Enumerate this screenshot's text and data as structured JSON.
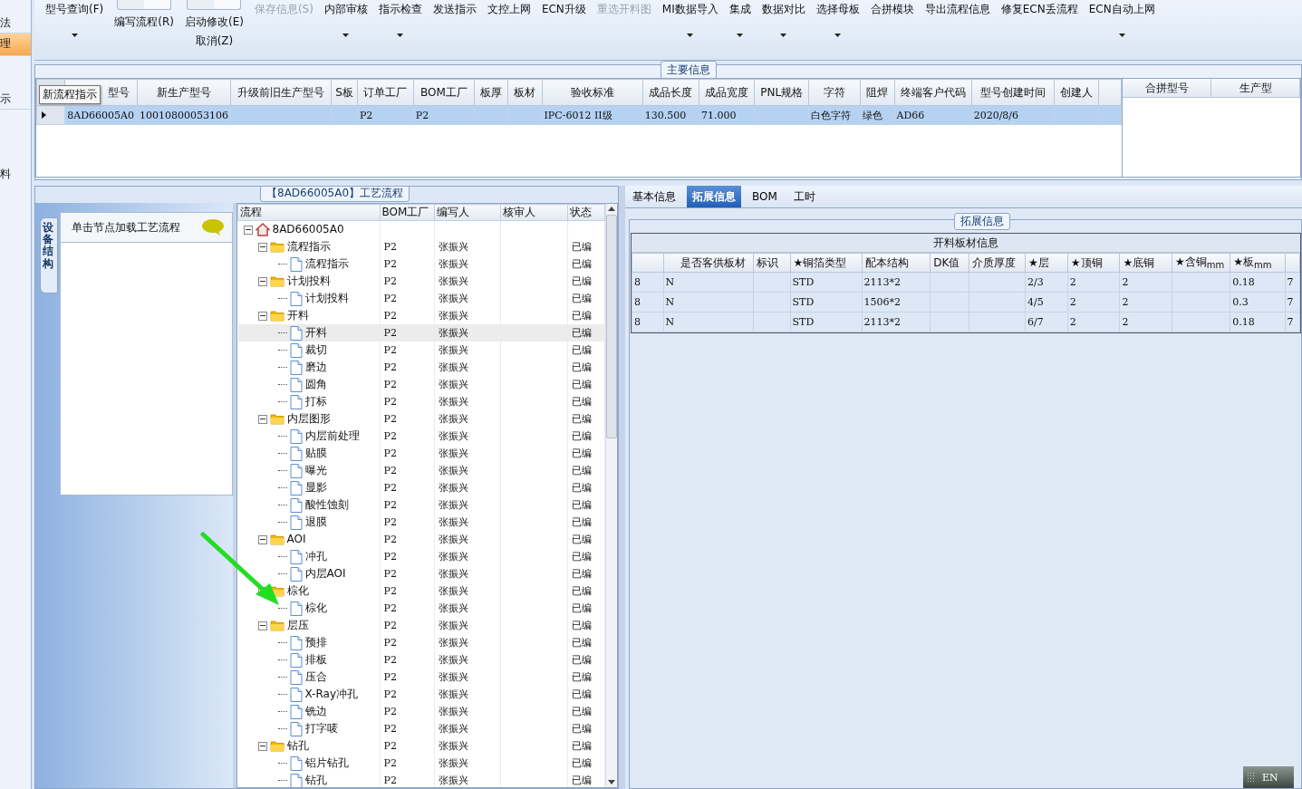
{
  "side_nav": [
    {
      "label": "法",
      "selected": false
    },
    {
      "label": "理",
      "selected": true
    },
    {
      "label": "示",
      "selected": false
    },
    {
      "label": "料",
      "selected": false
    }
  ],
  "toolbar": [
    {
      "kind": "menu",
      "label": "型号查询(F)",
      "dropdown": true,
      "disabled": false
    },
    {
      "kind": "toggle",
      "label": "编写流程(R)",
      "on": false
    },
    {
      "kind": "toggle",
      "label": "启动修改(E)",
      "sublabel": "取消(Z)",
      "on": false
    },
    {
      "kind": "menu",
      "label": "保存信息(S)",
      "dropdown": false,
      "disabled": true
    },
    {
      "kind": "menu",
      "label": "内部审核",
      "dropdown": true,
      "disabled": false
    },
    {
      "kind": "menu",
      "label": "指示检查",
      "dropdown": true,
      "disabled": false
    },
    {
      "kind": "menu",
      "label": "发送指示",
      "dropdown": false,
      "disabled": false
    },
    {
      "kind": "menu",
      "label": "文控上网",
      "dropdown": false,
      "disabled": false
    },
    {
      "kind": "menu",
      "label": "ECN升级",
      "dropdown": false,
      "disabled": false
    },
    {
      "kind": "menu",
      "label": "重选开料图",
      "dropdown": false,
      "disabled": true
    },
    {
      "kind": "menu",
      "label": "MI数据导入",
      "dropdown": true,
      "disabled": false
    },
    {
      "kind": "menu",
      "label": "集成",
      "dropdown": true,
      "disabled": false
    },
    {
      "kind": "menu",
      "label": "数据对比",
      "dropdown": true,
      "disabled": false
    },
    {
      "kind": "menu",
      "label": "选择母板",
      "dropdown": true,
      "disabled": false
    },
    {
      "kind": "menu",
      "label": "合拼模块",
      "dropdown": false,
      "disabled": false
    },
    {
      "kind": "menu",
      "label": "导出流程信息",
      "dropdown": false,
      "disabled": false
    },
    {
      "kind": "menu",
      "label": "修复ECN丢流程",
      "dropdown": false,
      "disabled": false
    },
    {
      "kind": "menu",
      "label": "ECN自动上网",
      "dropdown": true,
      "disabled": false
    }
  ],
  "main_info": {
    "title": "主要信息",
    "tooltip": "新流程指示",
    "columns": [
      "型号",
      "新生产型号",
      "升级前旧生产型号",
      "S板",
      "订单工厂",
      "BOM工厂",
      "板厚",
      "板材",
      "验收标准",
      "成品长度",
      "成品宽度",
      "PNL规格",
      "字符",
      "阻焊",
      "终端客户代码",
      "型号创建时间",
      "创建人"
    ],
    "rows": [
      {
        "selected": true,
        "cells": [
          "8AD66005A0",
          "10010800053106",
          "",
          "",
          "P2",
          "P2",
          "",
          "",
          "IPC-6012 II级",
          "130.500",
          "71.000",
          "",
          "白色字符",
          "绿色",
          "AD66",
          "2020/8/6",
          ""
        ]
      }
    ],
    "merge_columns": [
      "合拼型号",
      "生产型"
    ]
  },
  "process": {
    "title": "【8AD66005A0】工艺流程",
    "side_tab": "设备结构",
    "hint": "单击节点加载工艺流程",
    "columns": [
      "流程",
      "BOM工厂",
      "编写人",
      "核审人",
      "状态"
    ],
    "tree": [
      {
        "kind": "root",
        "label": "8AD66005A0",
        "selected": false,
        "expanded": true,
        "children": [
          {
            "kind": "folder",
            "label": "流程指示",
            "bom": "P2",
            "writer": "张振兴",
            "status": "已编",
            "selected": false,
            "expanded": true,
            "children": [
              {
                "kind": "file",
                "label": "流程指示",
                "bom": "P2",
                "writer": "张振兴",
                "status": "已编",
                "selected": false
              }
            ]
          },
          {
            "kind": "folder",
            "label": "计划投料",
            "bom": "P2",
            "writer": "张振兴",
            "status": "已编",
            "selected": false,
            "expanded": true,
            "children": [
              {
                "kind": "file",
                "label": "计划投料",
                "bom": "P2",
                "writer": "张振兴",
                "status": "已编",
                "selected": false
              }
            ]
          },
          {
            "kind": "folder",
            "label": "开料",
            "bom": "P2",
            "writer": "张振兴",
            "status": "已编",
            "selected": false,
            "expanded": true,
            "children": [
              {
                "kind": "file",
                "label": "开料",
                "bom": "P2",
                "writer": "张振兴",
                "status": "已编",
                "selected": true
              },
              {
                "kind": "file",
                "label": "裁切",
                "bom": "P2",
                "writer": "张振兴",
                "status": "已编",
                "selected": false
              },
              {
                "kind": "file",
                "label": "磨边",
                "bom": "P2",
                "writer": "张振兴",
                "status": "已编",
                "selected": false
              },
              {
                "kind": "file",
                "label": "圆角",
                "bom": "P2",
                "writer": "张振兴",
                "status": "已编",
                "selected": false
              },
              {
                "kind": "file",
                "label": "打标",
                "bom": "P2",
                "writer": "张振兴",
                "status": "已编",
                "selected": false
              }
            ]
          },
          {
            "kind": "folder",
            "label": "内层图形",
            "bom": "P2",
            "writer": "张振兴",
            "status": "已编",
            "selected": false,
            "expanded": true,
            "children": [
              {
                "kind": "file",
                "label": "内层前处理",
                "bom": "P2",
                "writer": "张振兴",
                "status": "已编",
                "selected": false
              },
              {
                "kind": "file",
                "label": "贴膜",
                "bom": "P2",
                "writer": "张振兴",
                "status": "已编",
                "selected": false
              },
              {
                "kind": "file",
                "label": "曝光",
                "bom": "P2",
                "writer": "张振兴",
                "status": "已编",
                "selected": false
              },
              {
                "kind": "file",
                "label": "显影",
                "bom": "P2",
                "writer": "张振兴",
                "status": "已编",
                "selected": false
              },
              {
                "kind": "file",
                "label": "酸性蚀刻",
                "bom": "P2",
                "writer": "张振兴",
                "status": "已编",
                "selected": false
              },
              {
                "kind": "file",
                "label": "退膜",
                "bom": "P2",
                "writer": "张振兴",
                "status": "已编",
                "selected": false
              }
            ]
          },
          {
            "kind": "folder",
            "label": "AOI",
            "bom": "P2",
            "writer": "张振兴",
            "status": "已编",
            "selected": false,
            "expanded": true,
            "children": [
              {
                "kind": "file",
                "label": "冲孔",
                "bom": "P2",
                "writer": "张振兴",
                "status": "已编",
                "selected": false
              },
              {
                "kind": "file",
                "label": "内层AOI",
                "bom": "P2",
                "writer": "张振兴",
                "status": "已编",
                "selected": false
              }
            ]
          },
          {
            "kind": "folder",
            "label": "棕化",
            "bom": "P2",
            "writer": "张振兴",
            "status": "已编",
            "selected": false,
            "expanded": true,
            "children": [
              {
                "kind": "file",
                "label": "棕化",
                "bom": "P2",
                "writer": "张振兴",
                "status": "已编",
                "selected": false
              }
            ]
          },
          {
            "kind": "folder",
            "label": "层压",
            "bom": "P2",
            "writer": "张振兴",
            "status": "已编",
            "selected": false,
            "expanded": true,
            "children": [
              {
                "kind": "file",
                "label": "预排",
                "bom": "P2",
                "writer": "张振兴",
                "status": "已编",
                "selected": false
              },
              {
                "kind": "file",
                "label": "排板",
                "bom": "P2",
                "writer": "张振兴",
                "status": "已编",
                "selected": false
              },
              {
                "kind": "file",
                "label": "压合",
                "bom": "P2",
                "writer": "张振兴",
                "status": "已编",
                "selected": false
              },
              {
                "kind": "file",
                "label": "X-Ray冲孔",
                "bom": "P2",
                "writer": "张振兴",
                "status": "已编",
                "selected": false
              },
              {
                "kind": "file",
                "label": "铣边",
                "bom": "P2",
                "writer": "张振兴",
                "status": "已编",
                "selected": false
              },
              {
                "kind": "file",
                "label": "打字唛",
                "bom": "P2",
                "writer": "张振兴",
                "status": "已编",
                "selected": false
              }
            ]
          },
          {
            "kind": "folder",
            "label": "钻孔",
            "bom": "P2",
            "writer": "张振兴",
            "status": "已编",
            "selected": false,
            "expanded": true,
            "children": [
              {
                "kind": "file",
                "label": "铝片钻孔",
                "bom": "P2",
                "writer": "张振兴",
                "status": "已编",
                "selected": false
              },
              {
                "kind": "file",
                "label": "钻孔",
                "bom": "P2",
                "writer": "张振兴",
                "status": "已编",
                "selected": false
              }
            ]
          }
        ]
      }
    ]
  },
  "detail": {
    "tabs": [
      {
        "label": "基本信息",
        "selected": false
      },
      {
        "label": "拓展信息",
        "selected": true
      },
      {
        "label": "BOM",
        "selected": false
      },
      {
        "label": "工时",
        "selected": false
      }
    ],
    "group_title": "拓展信息",
    "table_title": "开料板材信息",
    "columns": [
      "",
      "是否客供板材",
      "标识",
      "★铜箔类型",
      "配本结构",
      "DK值",
      "介质厚度",
      "★层",
      "★顶铜",
      "★底铜",
      "★含铜$_{mm}$",
      "★板$_{mm}$",
      ""
    ],
    "rows": [
      [
        "8",
        "N",
        "",
        "STD",
        "2113*2",
        "",
        "",
        "2/3",
        "2",
        "2",
        "",
        "0.18",
        "7"
      ],
      [
        "8",
        "N",
        "",
        "STD",
        "1506*2",
        "",
        "",
        "4/5",
        "2",
        "2",
        "",
        "0.3",
        "7"
      ],
      [
        "8",
        "N",
        "",
        "STD",
        "2113*2",
        "",
        "",
        "6/7",
        "2",
        "2",
        "",
        "0.18",
        "7"
      ]
    ]
  },
  "ime": {
    "label": "EN"
  }
}
